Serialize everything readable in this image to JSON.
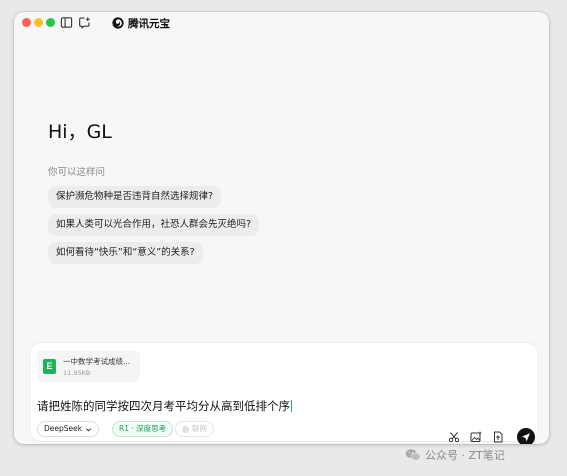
{
  "window": {
    "app_title": "腾讯元宝",
    "icons": [
      "sidebar-toggle-icon",
      "new-chat-icon",
      "yuanbao-logo-icon"
    ]
  },
  "home": {
    "greeting": "Hi，GL",
    "suggestions_label": "你可以这样问",
    "suggestions": [
      "保护濒危物种是否违背自然选择规律?",
      "如果人类可以光合作用，社恐人群会先灭绝吗?",
      "如何看待“快乐”和“意义”的关系?"
    ]
  },
  "composer": {
    "attachment": {
      "name": "一中数学考试成绩...",
      "size": "11.95KB",
      "icon": "E",
      "icon_color": "#1fb25a"
    },
    "input_value": "请把姓陈的同学按四次月考平均分从高到低排个序",
    "model_selector": "DeepSeek",
    "deep_think_label": "R1 · 深度思考",
    "web_search_label": "联网",
    "accent_color": "#18a15a",
    "tools": [
      "scissors-icon",
      "image-upload-icon",
      "file-upload-icon",
      "send-icon"
    ]
  },
  "watermark": {
    "text": "公众号 · ZT笔记"
  }
}
